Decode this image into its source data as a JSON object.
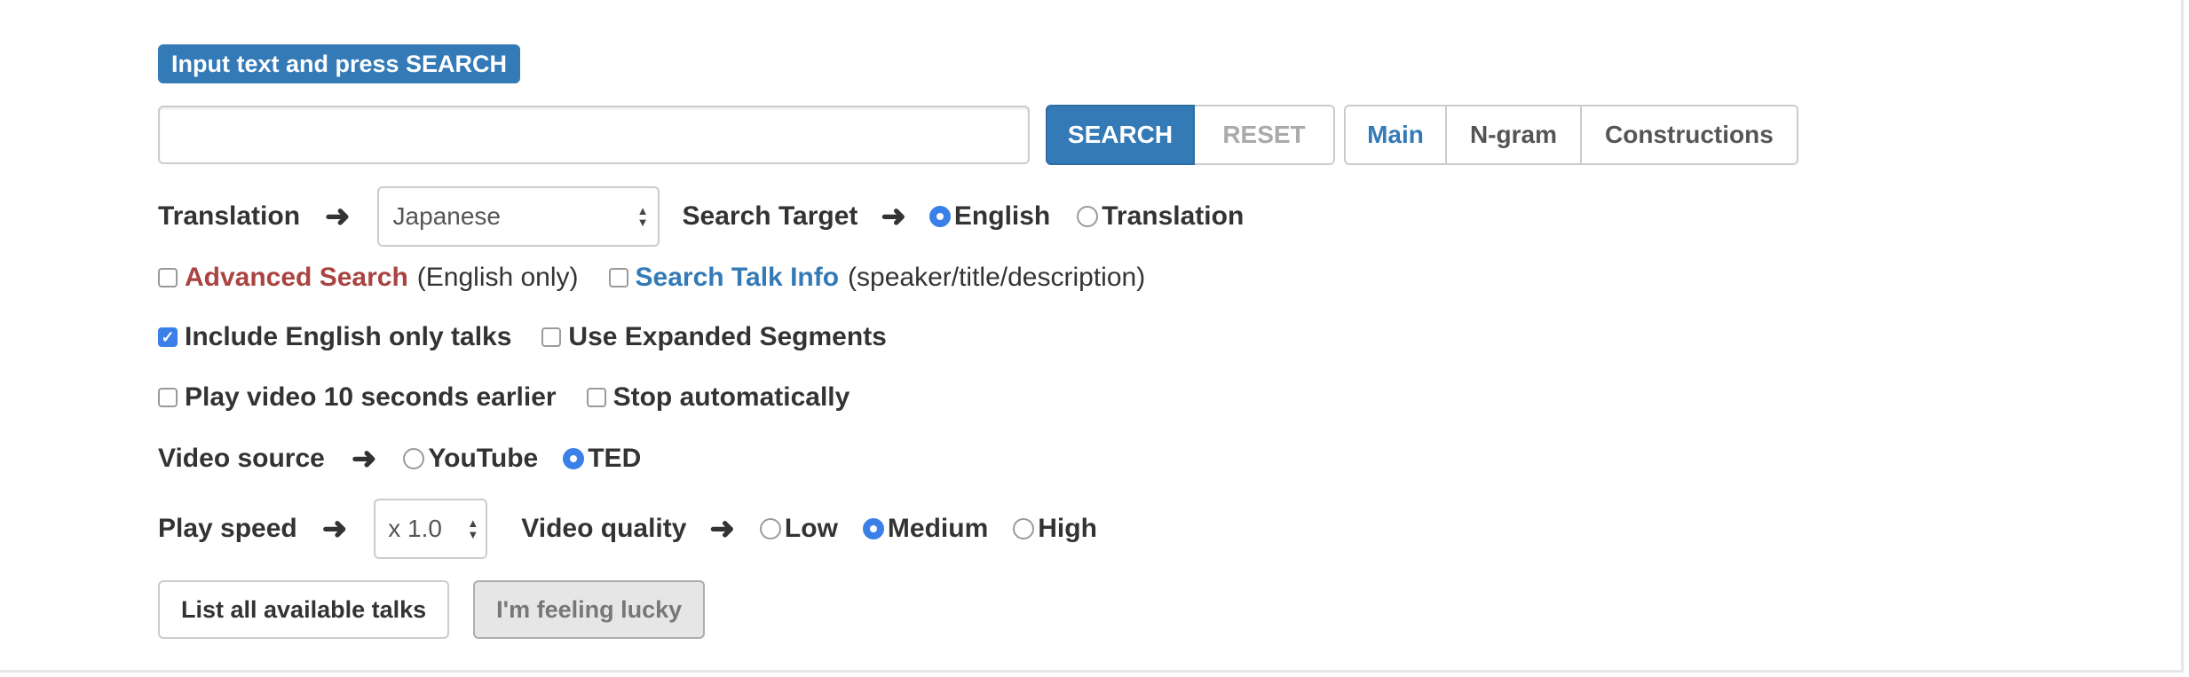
{
  "header": {
    "badge": "Input text and press SEARCH"
  },
  "search": {
    "value": "",
    "placeholder": "",
    "search_label": "SEARCH",
    "reset_label": "RESET",
    "tabs": [
      "Main",
      "N-gram",
      "Constructions"
    ]
  },
  "translation": {
    "label": "Translation",
    "selected": "Japanese"
  },
  "search_target": {
    "label": "Search Target",
    "options": [
      "English",
      "Translation"
    ],
    "selected": "English"
  },
  "advanced": {
    "label": "Advanced Search",
    "note": "(English only)",
    "checked": false
  },
  "talk_info": {
    "label": "Search Talk Info",
    "note": "(speaker/title/description)",
    "checked": false
  },
  "include_english": {
    "label": "Include English only talks",
    "checked": true
  },
  "expanded": {
    "label": "Use Expanded Segments",
    "checked": false
  },
  "play_earlier": {
    "label": "Play video 10 seconds earlier",
    "checked": false
  },
  "stop_auto": {
    "label": "Stop automatically",
    "checked": false
  },
  "video_source": {
    "label": "Video source",
    "options": [
      "YouTube",
      "TED"
    ],
    "selected": "TED"
  },
  "play_speed": {
    "label": "Play speed",
    "selected": "x 1.0"
  },
  "video_quality": {
    "label": "Video quality",
    "options": [
      "Low",
      "Medium",
      "High"
    ],
    "selected": "Medium"
  },
  "actions": {
    "list_label": "List all available talks",
    "lucky_label": "I'm feeling lucky"
  },
  "colors": {
    "primary": "#337ab7",
    "danger": "#a94442",
    "radio_active": "#3b7fe8"
  },
  "icons": {
    "arrow": "arrow-right-icon",
    "caret": "sort-caret-icon"
  }
}
